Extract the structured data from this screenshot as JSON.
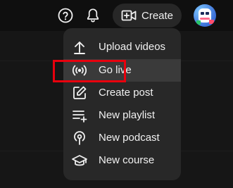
{
  "header": {
    "create_label": "Create",
    "icons": {
      "help": "help-circle-icon",
      "notifications": "bell-icon",
      "create": "video-plus-icon",
      "avatar": "avatar"
    }
  },
  "create_menu": {
    "items": [
      {
        "label": "Upload videos",
        "icon": "upload-icon"
      },
      {
        "label": "Go live",
        "icon": "broadcast-icon",
        "highlighted": true
      },
      {
        "label": "Create post",
        "icon": "edit-icon"
      },
      {
        "label": "New playlist",
        "icon": "playlist-add-icon"
      },
      {
        "label": "New podcast",
        "icon": "podcast-icon"
      },
      {
        "label": "New course",
        "icon": "graduation-cap-icon"
      }
    ]
  },
  "colors": {
    "background": "#0f0f0f",
    "menu": "#282828",
    "text": "#f1f1f1",
    "highlight_box": "#e8000d"
  }
}
